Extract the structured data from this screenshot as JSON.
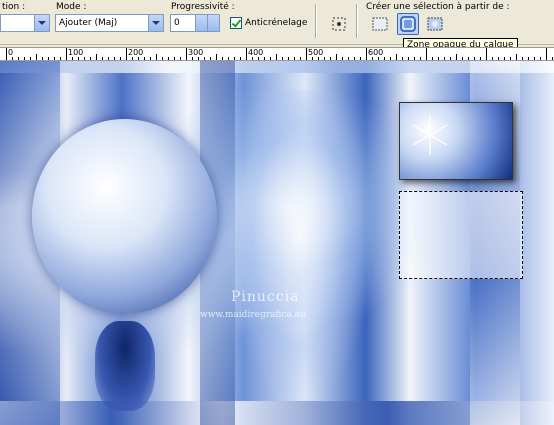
{
  "toolbar": {
    "selection_label": "tion :",
    "mode_label": "Mode :",
    "mode_value": "Ajouter (Maj)",
    "progressivity_label": "Progressivité :",
    "progressivity_value": "0",
    "antialias_label": "Anticrénelage",
    "antialias_checked": true,
    "create_selection_label": "Créer une sélection à partir de :",
    "buttons": [
      {
        "name": "selection-from-layer-icon"
      },
      {
        "name": "opaque-area-icon",
        "active": true
      },
      {
        "name": "mask-selection-icon"
      }
    ],
    "tooltip": "Zone opaque du calque"
  },
  "ruler": {
    "labels": [
      "0",
      "100",
      "200",
      "300",
      "400",
      "500",
      "600"
    ]
  },
  "canvas": {
    "watermark_title": "Pinuccia",
    "watermark_url": "www.maidiregrafica.eu"
  },
  "colors": {
    "toolbar_bg": "#ece9d8",
    "accent": "#316ac5",
    "canvas_dark": "#1f3f94",
    "canvas_light": "#eef3fb"
  }
}
